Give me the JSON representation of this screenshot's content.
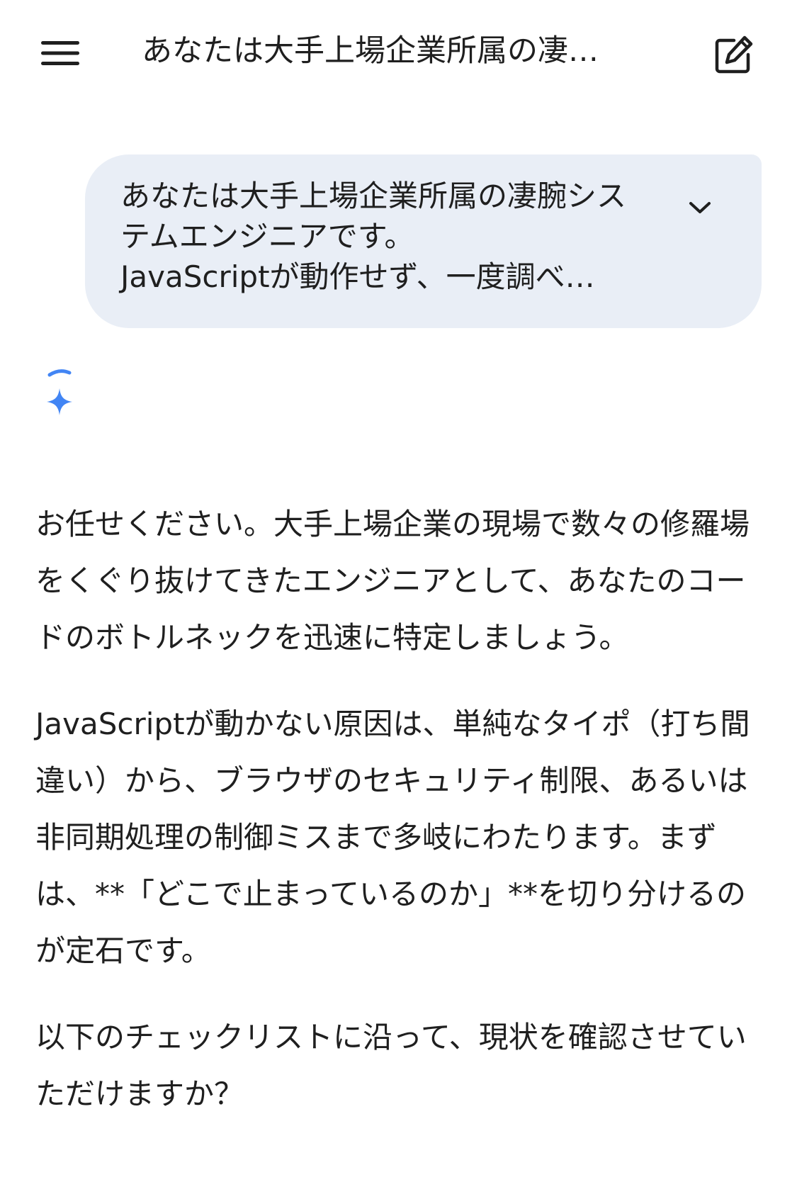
{
  "header": {
    "menu_icon": "hamburger-menu-icon",
    "title": "あなたは大手上場企業所属の凄…",
    "new_chat_icon": "edit-square-icon"
  },
  "prompt": {
    "lines": [
      "あなたは大手上場企業所属の凄腕シス",
      "テムエンジニアです。",
      "JavaScriptが動作せず、一度調べ…"
    ],
    "expand_icon": "chevron-down-icon",
    "background": "#e9eef6"
  },
  "assistant": {
    "avatar_icon": "gemini-spark-icon",
    "accent": "#4285f4",
    "paragraphs": [
      "お任せください。大手上場企業の現場で数々の修羅場をくぐり抜けてきたエンジニアとして、あなたのコードのボトルネックを迅速に特定しましょう。",
      "JavaScriptが動かない原因は、単純なタイポ（打ち間違い）から、ブラウザのセキュリティ制限、あるいは非同期処理の制御ミスまで多岐にわたります。まずは、**「どこで止まっているのか」**を切り分けるのが定石です。",
      "以下のチェックリストに沿って、現状を確認させていただけますか？"
    ]
  }
}
